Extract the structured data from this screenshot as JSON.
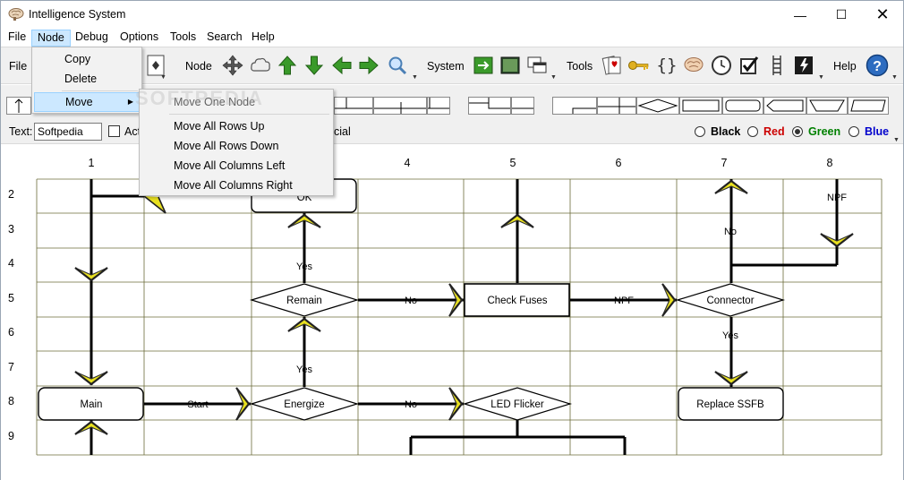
{
  "window": {
    "title": "Intelligence System",
    "minimize": "—",
    "maximize": "☐",
    "close": "✕"
  },
  "menubar": [
    "File",
    "Node",
    "Debug",
    "Options",
    "Tools",
    "Search",
    "Help"
  ],
  "toolbar": {
    "file_label": "File",
    "node_label": "Node",
    "system_label": "System",
    "tools_label": "Tools",
    "help_label": "Help",
    "dropdown_marker": "▼"
  },
  "textrow": {
    "text_label": "Text:",
    "text_value": "Softpedia",
    "check_label_partial": "Act",
    "check2_label_partial": "cial",
    "colors": [
      {
        "label": "Black",
        "hex": "#000000",
        "checked": false
      },
      {
        "label": "Red",
        "hex": "#cc0000",
        "checked": false
      },
      {
        "label": "Green",
        "hex": "#008000",
        "checked": true
      },
      {
        "label": "Blue",
        "hex": "#0000cc",
        "checked": false
      }
    ]
  },
  "node_menu": {
    "items": [
      "Copy",
      "Delete",
      "Move"
    ],
    "submenu_arrow": "▶"
  },
  "move_submenu": {
    "items": [
      "Move One Node",
      "Move All Rows Up",
      "Move All Rows Down",
      "Move All Columns Left",
      "Move All Columns Right"
    ]
  },
  "watermark": "SOFTPEDIA",
  "grid": {
    "columns": [
      "1",
      "4",
      "5",
      "6",
      "7",
      "8"
    ],
    "rows": [
      "2",
      "3",
      "4",
      "5",
      "6",
      "7",
      "8",
      "9"
    ]
  },
  "nodes": {
    "ok": "OK",
    "remain": "Remain",
    "check_fuses": "Check Fuses",
    "connector": "Connector",
    "main": "Main",
    "energize": "Energize",
    "led_flicker": "LED Flicker",
    "replace_ssfb": "Replace SSFB"
  },
  "edge_labels": {
    "yes_ok": "Yes",
    "no_remain": "No",
    "npf_fuses": "NPF",
    "no_col7": "No",
    "npf_col8": "NPF",
    "yes_connector": "Yes",
    "yes_energize": "Yes",
    "start": "Start",
    "no_energize": "No"
  },
  "colors": {
    "grid_line": "#6b6b3a",
    "arrow_fill": "#e8e020",
    "menu_highlight": "#cce8ff"
  }
}
